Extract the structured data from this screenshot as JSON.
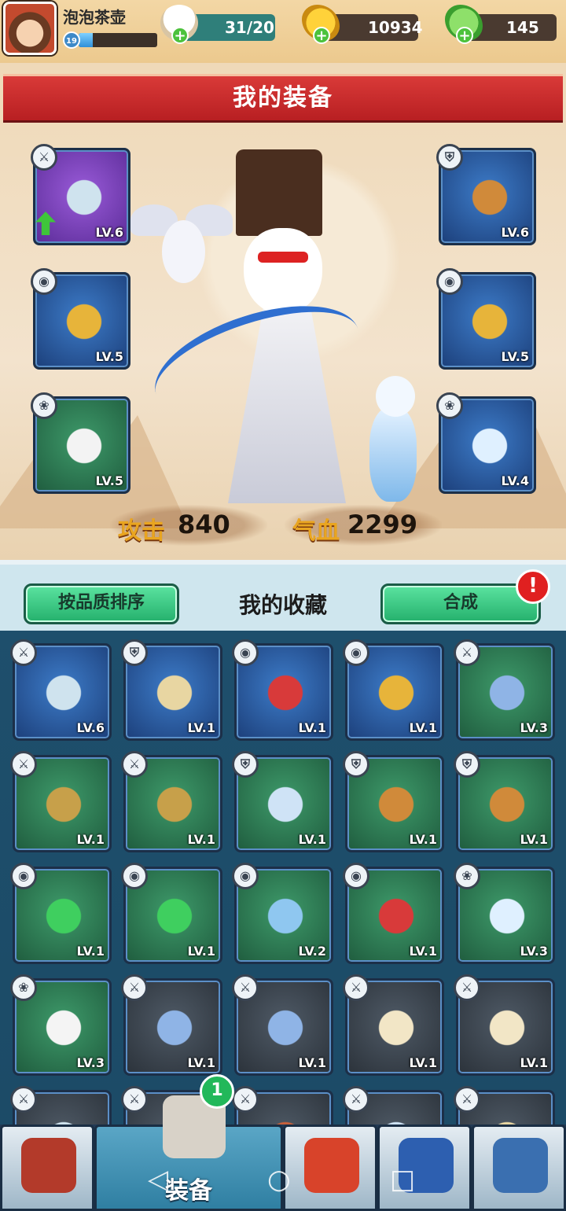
{
  "player": {
    "name": "泡泡茶壶",
    "level": "19",
    "xp_fraction": 0.18
  },
  "resources": {
    "stamina": "31/20",
    "gold": "10934",
    "jade": "145"
  },
  "equipment": {
    "title": "我的装备",
    "slots_left": [
      {
        "icon": "bow-icon",
        "type": "weapon",
        "lv": "LV.6",
        "rarity": "purple",
        "upgradeable": true
      },
      {
        "icon": "jade-pendant-icon",
        "type": "accessory",
        "lv": "LV.5",
        "rarity": "blue"
      },
      {
        "icon": "eagle-pet-icon",
        "type": "pet",
        "lv": "LV.5",
        "rarity": "green"
      }
    ],
    "slots_right": [
      {
        "icon": "armor-icon",
        "type": "armor",
        "lv": "LV.6",
        "rarity": "blue"
      },
      {
        "icon": "jade-pendant-icon",
        "type": "accessory",
        "lv": "LV.5",
        "rarity": "blue"
      },
      {
        "icon": "ferret-pet-icon",
        "type": "pet",
        "lv": "LV.4",
        "rarity": "blue"
      }
    ],
    "attack_label": "攻击",
    "attack_value": "840",
    "hp_label": "气血",
    "hp_value": "2299"
  },
  "collection": {
    "sort_label": "按品质排序",
    "title": "我的收藏",
    "compose_label": "合成",
    "compose_alert": "!",
    "items": [
      {
        "icon": "bow-icon",
        "type": "weapon",
        "lv": "LV.6",
        "rarity": "blue"
      },
      {
        "icon": "robe-icon",
        "type": "armor",
        "lv": "LV.1",
        "rarity": "blue"
      },
      {
        "icon": "red-pendant-icon",
        "type": "accessory",
        "lv": "LV.1",
        "rarity": "blue"
      },
      {
        "icon": "jade-pendant-icon",
        "type": "accessory",
        "lv": "LV.1",
        "rarity": "blue"
      },
      {
        "icon": "sword-icon",
        "type": "weapon",
        "lv": "LV.3",
        "rarity": "green"
      },
      {
        "icon": "horn-icon",
        "type": "weapon",
        "lv": "LV.1",
        "rarity": "green"
      },
      {
        "icon": "horn-icon",
        "type": "weapon",
        "lv": "LV.1",
        "rarity": "green"
      },
      {
        "icon": "fur-cloak-icon",
        "type": "armor",
        "lv": "LV.1",
        "rarity": "green"
      },
      {
        "icon": "armor-icon",
        "type": "armor",
        "lv": "LV.1",
        "rarity": "green"
      },
      {
        "icon": "armor-icon",
        "type": "armor",
        "lv": "LV.1",
        "rarity": "green"
      },
      {
        "icon": "green-pendant-icon",
        "type": "accessory",
        "lv": "LV.1",
        "rarity": "green"
      },
      {
        "icon": "green-pendant-icon",
        "type": "accessory",
        "lv": "LV.1",
        "rarity": "green"
      },
      {
        "icon": "blue-pendant-icon",
        "type": "accessory",
        "lv": "LV.2",
        "rarity": "green"
      },
      {
        "icon": "red-pendant-icon",
        "type": "accessory",
        "lv": "LV.1",
        "rarity": "green"
      },
      {
        "icon": "ferret-pet-icon",
        "type": "pet",
        "lv": "LV.3",
        "rarity": "green"
      },
      {
        "icon": "panda-pet-icon",
        "type": "pet",
        "lv": "LV.3",
        "rarity": "green"
      },
      {
        "icon": "sword-icon",
        "type": "weapon",
        "lv": "LV.1",
        "rarity": "gray"
      },
      {
        "icon": "sword-icon",
        "type": "weapon",
        "lv": "LV.1",
        "rarity": "gray"
      },
      {
        "icon": "fan-icon",
        "type": "weapon",
        "lv": "LV.1",
        "rarity": "gray"
      },
      {
        "icon": "fan-icon",
        "type": "weapon",
        "lv": "LV.1",
        "rarity": "gray"
      },
      {
        "icon": "bow-icon",
        "type": "weapon",
        "lv": "",
        "rarity": "gray"
      },
      {
        "icon": "sword-icon",
        "type": "weapon",
        "lv": "",
        "rarity": "gray"
      },
      {
        "icon": "hat-icon",
        "type": "weapon",
        "lv": "",
        "rarity": "gray"
      },
      {
        "icon": "fur-cloak-icon",
        "type": "weapon",
        "lv": "",
        "rarity": "gray"
      },
      {
        "icon": "robe-icon",
        "type": "weapon",
        "lv": "",
        "rarity": "gray"
      }
    ]
  },
  "nav": {
    "tabs": [
      {
        "name": "shop-tab",
        "icon": "shop-icon",
        "label": ""
      },
      {
        "name": "equipment-tab",
        "icon": "equipment-icon",
        "label": "装备",
        "active": true,
        "badge": "1"
      },
      {
        "name": "rooster-tab",
        "icon": "rooster-icon",
        "label": ""
      },
      {
        "name": "book-tab",
        "icon": "book-icon",
        "label": ""
      },
      {
        "name": "settings-tab",
        "icon": "gear-icon",
        "label": ""
      }
    ]
  }
}
